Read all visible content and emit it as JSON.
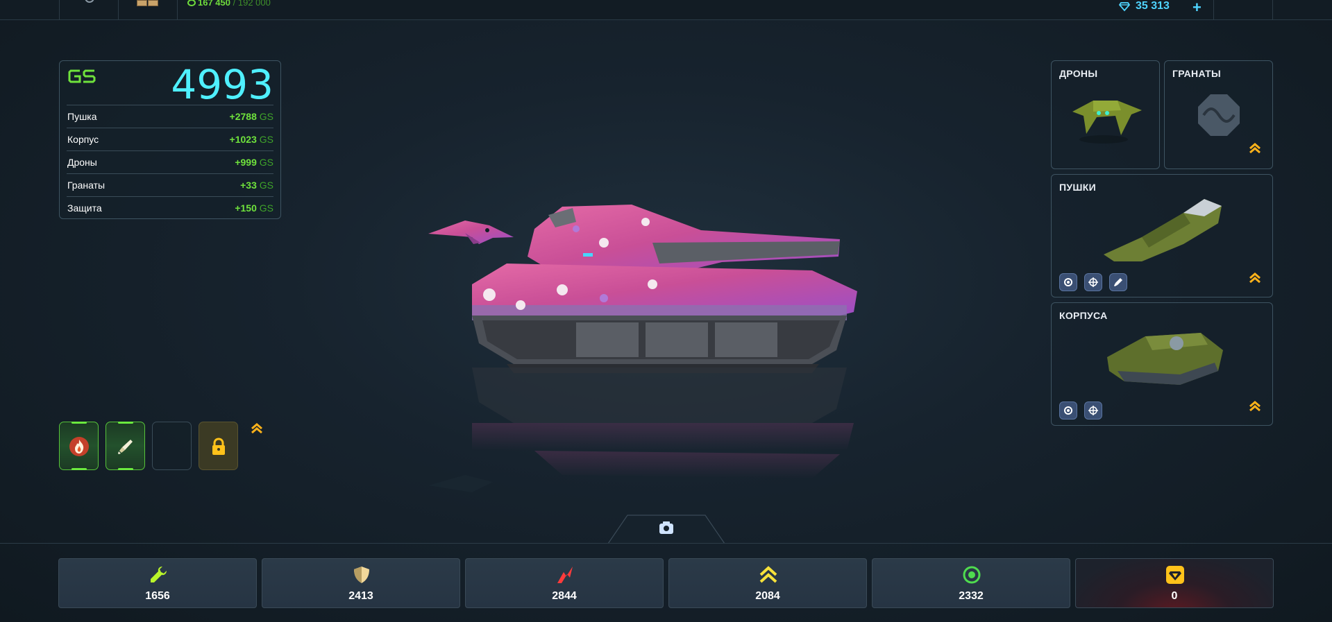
{
  "topbar": {
    "experience_current": "167 450",
    "experience_max": "192 000",
    "crystals": "35 313",
    "add_label": "+"
  },
  "gs_panel": {
    "label": "GS",
    "total": "4993",
    "unit": "GS",
    "rows": [
      {
        "name": "Пушка",
        "value": "+2788"
      },
      {
        "name": "Корпус",
        "value": "+1023"
      },
      {
        "name": "Дроны",
        "value": "+999"
      },
      {
        "name": "Гранаты",
        "value": "+33"
      },
      {
        "name": "Защита",
        "value": "+150"
      }
    ]
  },
  "equipment": {
    "drones_title": "ДРОНЫ",
    "grenades_title": "ГРАНАТЫ",
    "turrets_title": "ПУШКИ",
    "hulls_title": "КОРПУСА"
  },
  "stats": [
    {
      "name": "repair",
      "value": "1656",
      "color": "#b9f52a"
    },
    {
      "name": "armor",
      "value": "2413",
      "color": "#f2d89a"
    },
    {
      "name": "damage",
      "value": "2844",
      "color": "#ff3b3b"
    },
    {
      "name": "speed",
      "value": "2084",
      "color": "#f7e23a"
    },
    {
      "name": "mines",
      "value": "2332",
      "color": "#4fdc4f"
    },
    {
      "name": "crystal-box",
      "value": "0",
      "color": "#ffc21a"
    }
  ],
  "colors": {
    "accent_cyan": "#4ff0ff",
    "gs_green": "#6fe23c",
    "upgrade_orange": "#ffb21a"
  }
}
